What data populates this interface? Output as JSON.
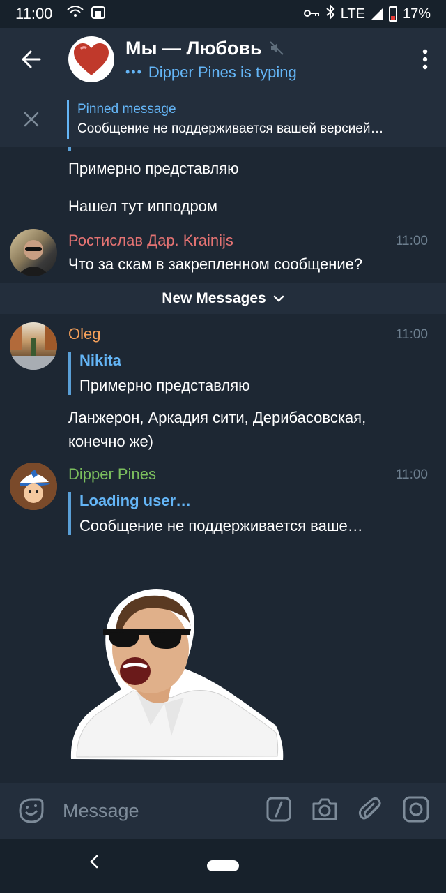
{
  "status_bar": {
    "time": "11:00",
    "network": "LTE",
    "battery": "17%"
  },
  "header": {
    "title": "Мы — Любовь",
    "status": "Dipper Pines is typing",
    "typing_dots": "•••"
  },
  "pinned": {
    "title": "Pinned message",
    "text": "Сообщение не поддерживается вашей версией…"
  },
  "messages": {
    "plain1": "Примерно представляю",
    "plain2": "Нашел тут ипподром",
    "rostislav": {
      "sender": "Ростислав Дар. Krainijs",
      "time": "11:00",
      "text": "Что за скам в закрепленном сообщение?",
      "color": "#e57373"
    },
    "new_messages_label": "New Messages",
    "oleg": {
      "sender": "Oleg",
      "time": "11:00",
      "reply_name": "Nikita",
      "reply_text": "Примерно представляю",
      "text": "Ланжерон, Аркадия сити, Дерибасовская, конечно же)",
      "color": "#f5a05a"
    },
    "dipper": {
      "sender": "Dipper Pines",
      "time": "11:00",
      "reply_name": "Loading user…",
      "reply_text": "Сообщение не поддерживается ваше…",
      "color": "#7cbf5e"
    }
  },
  "composer": {
    "placeholder": "Message"
  }
}
